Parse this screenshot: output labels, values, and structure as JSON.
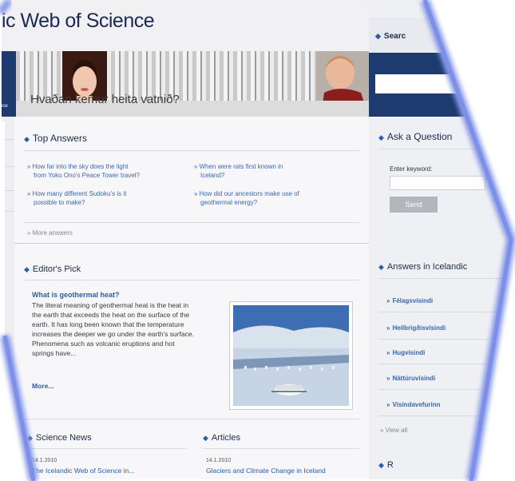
{
  "site": {
    "title": "ic Web of Science"
  },
  "banner": {
    "question": "Hvaðan kemur heita vatnið?",
    "nav_label": "nce"
  },
  "top_answers": {
    "title": "Top Answers",
    "col1": [
      {
        "line1": "How far into the sky does the light",
        "line2": "from Yoko Ono's Peace Tower travel?"
      },
      {
        "line1": "How many different Sudoku's is it",
        "line2": "possible to make?"
      }
    ],
    "col2": [
      {
        "line1": "When were rats first known in",
        "line2": "Iceland?"
      },
      {
        "line1": "How did our ancestors make use of",
        "line2": "geothermal energy?"
      }
    ],
    "more": "More answers"
  },
  "editors_pick": {
    "title": "Editor's Pick",
    "question": "What is geothermal heat?",
    "body_lines": [
      "The literal meaning of geothermal heat is the heat in",
      "the earth that exceeds the heat on the surface of the",
      "earth. It has long been known that the temperature",
      "increases the deeper we go under the earth's surface.",
      "Phenomena such as volcanic eruptions and hot",
      "springs have..."
    ],
    "more": "More..."
  },
  "science_news": {
    "title": "Science News",
    "date": "14.1.2010",
    "headline": "The Icelandic Web of Science in..."
  },
  "articles": {
    "title": "Articles",
    "date": "14.1.2010",
    "headline": "Glaciers and Climate Change in Iceland"
  },
  "right": {
    "search_title": "Searc",
    "ask_title": "Ask a Question",
    "keyword_label": "Enter keyword:",
    "send_label": "Send",
    "icelandic_title": "Answers in Icelandic",
    "icelandic_links": [
      "Félagsvísindi",
      "Heilbrigðisvísindi",
      "Hugvísindi",
      "Náttúruvísindi",
      "Vísindavefurinn"
    ],
    "view_all": "View all",
    "bottom_title": "R"
  },
  "colors": {
    "frame": "#8a9bea",
    "navy": "#1d3b6f",
    "link": "#3b67b0"
  }
}
